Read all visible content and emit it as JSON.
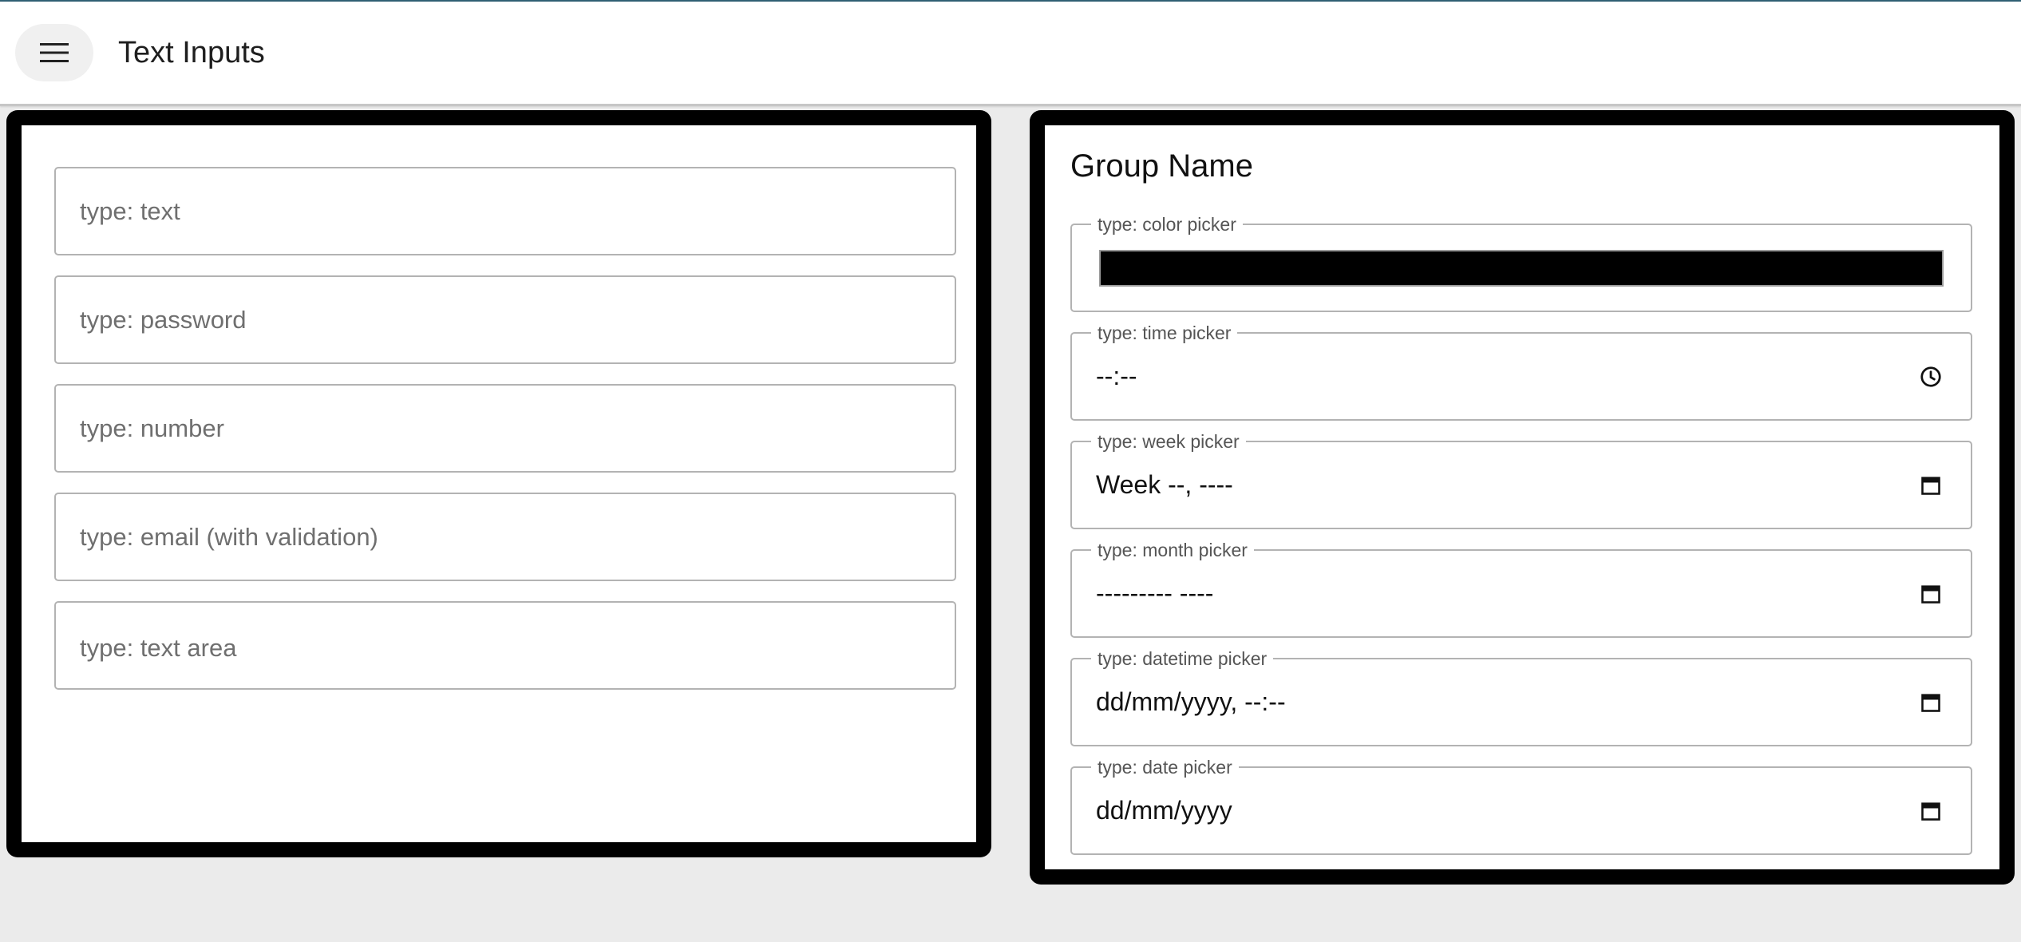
{
  "appbar": {
    "title": "Text Inputs",
    "menu_icon": "hamburger-menu-icon"
  },
  "left_card": {
    "fields": [
      {
        "type": "text",
        "placeholder": "type: text"
      },
      {
        "type": "password",
        "placeholder": "type: password"
      },
      {
        "type": "number",
        "placeholder": "type: number"
      },
      {
        "type": "email",
        "placeholder": "type: email (with validation)"
      },
      {
        "type": "textarea",
        "placeholder": "type: text area"
      }
    ]
  },
  "right_card": {
    "title": "Group Name",
    "fields": [
      {
        "label": "type: color picker",
        "value": "",
        "color": "#000000"
      },
      {
        "label": "type: time picker",
        "value": "--:--",
        "icon": "clock-icon"
      },
      {
        "label": "type: week picker",
        "value": "Week --, ----",
        "icon": "calendar-icon"
      },
      {
        "label": "type: month picker",
        "value": "--------- ----",
        "icon": "calendar-icon"
      },
      {
        "label": "type: datetime picker",
        "value": "dd/mm/yyyy, --:--",
        "icon": "calendar-icon"
      },
      {
        "label": "type: date picker",
        "value": "dd/mm/yyyy",
        "icon": "calendar-icon"
      }
    ]
  },
  "colors": {
    "accent_line": "#2f5f73",
    "background": "#ebebeb",
    "card_border": "#000000"
  }
}
